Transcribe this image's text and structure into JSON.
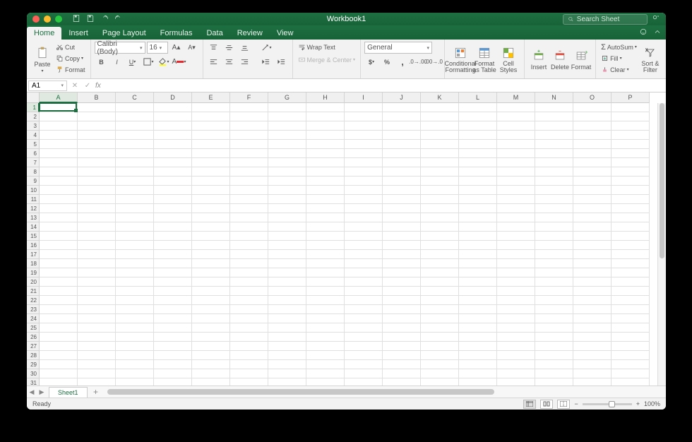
{
  "title": "Workbook1",
  "search": {
    "placeholder": "Search Sheet"
  },
  "tabs": [
    "Home",
    "Insert",
    "Page Layout",
    "Formulas",
    "Data",
    "Review",
    "View"
  ],
  "activeTab": "Home",
  "clipboard": {
    "paste": "Paste",
    "cut": "Cut",
    "copy": "Copy",
    "format": "Format"
  },
  "font": {
    "name": "Calibri (Body)",
    "size": "16"
  },
  "alignment": {
    "wrap": "Wrap Text",
    "merge": "Merge & Center"
  },
  "numfmt": {
    "name": "General"
  },
  "styles": {
    "cond": "Conditional Formatting",
    "table": "Format as Table",
    "cell": "Cell Styles"
  },
  "cellsGroup": {
    "insert": "Insert",
    "delete": "Delete",
    "format": "Format"
  },
  "editing": {
    "autosum": "AutoSum",
    "fill": "Fill",
    "clear": "Clear",
    "sort": "Sort & Filter"
  },
  "namebox": "A1",
  "columns": [
    "A",
    "B",
    "C",
    "D",
    "E",
    "F",
    "G",
    "H",
    "I",
    "J",
    "K",
    "L",
    "M",
    "N",
    "O",
    "P"
  ],
  "rows": [
    "1",
    "2",
    "3",
    "4",
    "5",
    "6",
    "7",
    "8",
    "9",
    "10",
    "11",
    "12",
    "13",
    "14",
    "15",
    "16",
    "17",
    "18",
    "19",
    "20",
    "21",
    "22",
    "23",
    "24",
    "25",
    "26",
    "27",
    "28",
    "29",
    "30",
    "31"
  ],
  "activeCell": {
    "col": 0,
    "row": 0
  },
  "sheet": {
    "name": "Sheet1"
  },
  "status": {
    "text": "Ready",
    "zoom": "100%"
  }
}
